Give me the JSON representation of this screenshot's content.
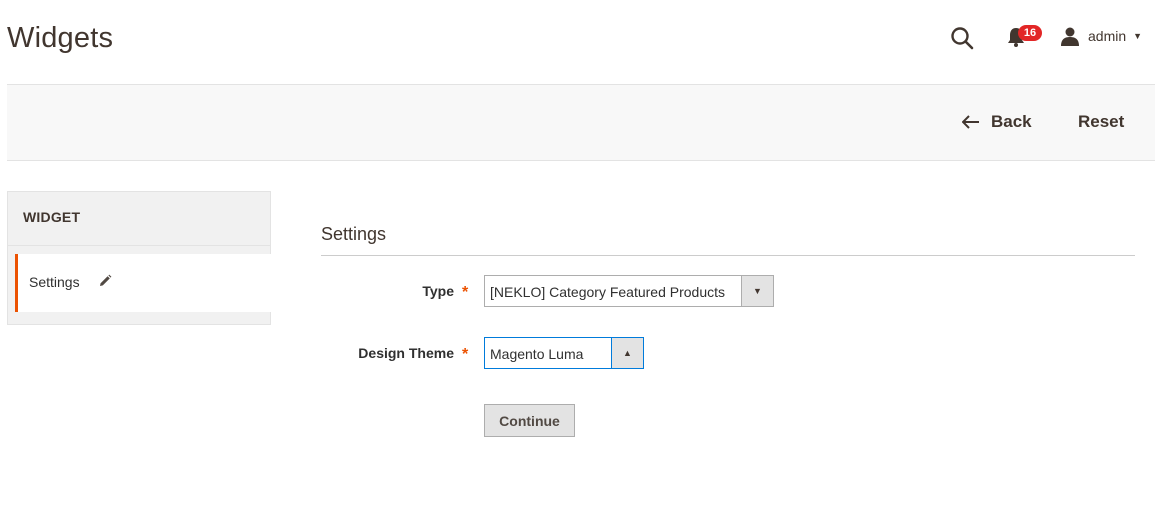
{
  "header": {
    "title": "Widgets",
    "notifications_count": "16",
    "user_name": "admin",
    "icons": {
      "search": "search-icon",
      "notifications": "bell-icon",
      "user": "user-icon",
      "user_menu": "caret-down-icon"
    },
    "colors": {
      "badge": "#e22626"
    }
  },
  "action_bar": {
    "back_label": "Back",
    "reset_label": "Reset"
  },
  "sidebar": {
    "title": "WIDGET",
    "items": [
      {
        "label": "Settings",
        "icon": "pencil-icon",
        "active": true
      }
    ],
    "colors": {
      "active_accent": "#eb5202"
    }
  },
  "main": {
    "section_title": "Settings",
    "fields": {
      "type": {
        "label": "Type",
        "required_mark": "*",
        "value": "[NEKLO] Category Featured Products"
      },
      "design_theme": {
        "label": "Design Theme",
        "required_mark": "*",
        "value": "Magento Luma"
      }
    },
    "continue_label": "Continue"
  }
}
